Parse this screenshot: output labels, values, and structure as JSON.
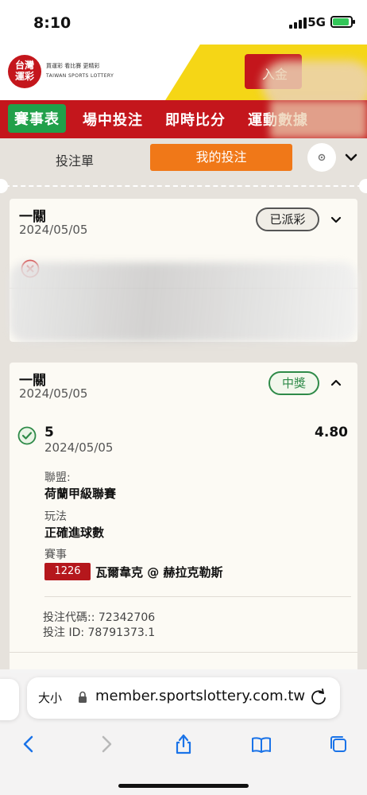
{
  "status_bar": {
    "time": "8:10",
    "network": "5G"
  },
  "header": {
    "logo_line1": "台灣",
    "logo_line2": "運彩",
    "logo_tagline": "買運彩  看比賽  更精彩",
    "logo_english": "TAIWAN SPORTS LOTTERY",
    "deposit_label": "入金"
  },
  "nav": {
    "items": [
      {
        "label": "賽事表"
      },
      {
        "label": "場中投注"
      },
      {
        "label": "即時比分"
      },
      {
        "label": "運動數據"
      }
    ]
  },
  "tabs": {
    "bet_slip": "投注單",
    "my_bets": "我的投注"
  },
  "bets": [
    {
      "title": "一關",
      "date": "2024/05/05",
      "status": "已派彩",
      "status_color": "#555555"
    },
    {
      "title": "一關",
      "date": "2024/05/05",
      "status": "中獎",
      "status_color": "#2e8a48",
      "selection": "5",
      "odds": "4.80",
      "selection_date": "2024/05/05",
      "league_label": "聯盟:",
      "league": "荷蘭甲級聯賽",
      "market_label": "玩法",
      "market": "正確進球數",
      "event_label": "賽事",
      "event_code": "1226",
      "event_name": "瓦爾韋克 @ 赫拉克勒斯",
      "bet_code": "投注代碼:: 72342706",
      "bet_id": "投注 ID: 78791373.1"
    }
  ],
  "browser": {
    "text_size": "大小",
    "url": "member.sportslottery.com.tw"
  },
  "colors": {
    "brand_red": "#c4161c",
    "active_green": "#21a04a",
    "tab_orange": "#f07818",
    "brand_yellow": "#f5d616"
  }
}
